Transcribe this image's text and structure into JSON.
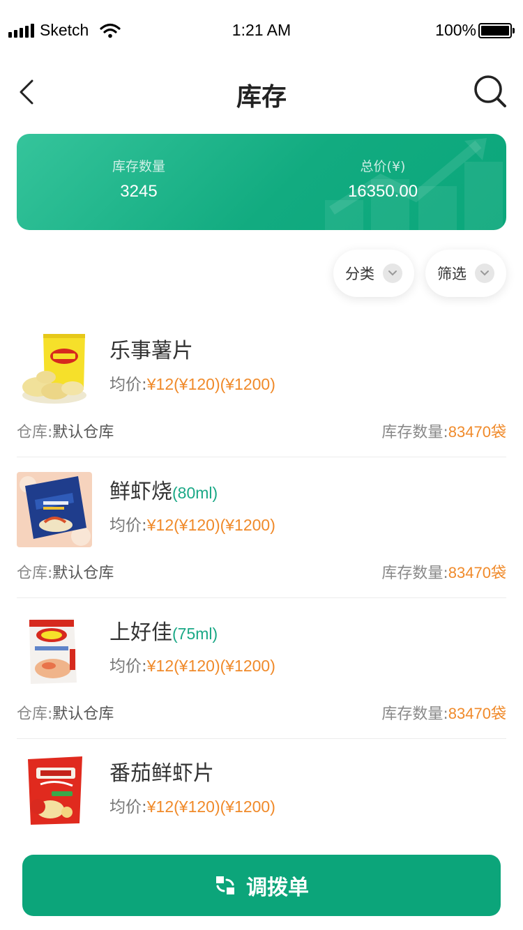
{
  "status_bar": {
    "carrier": "Sketch",
    "time": "1:21 AM",
    "battery": "100%"
  },
  "nav": {
    "title": "库存",
    "back_icon": "chevron-left-icon",
    "search_icon": "search-icon"
  },
  "summary": {
    "stock_label": "库存数量",
    "stock_value": "3245",
    "total_label": "总价(¥)",
    "total_value": "16350.00"
  },
  "filters": {
    "category_label": "分类",
    "filter_label": "筛选"
  },
  "products": [
    {
      "name": "乐事薯片",
      "spec": "",
      "price_label": "均价:",
      "price_value": "¥12(¥120)(¥1200)",
      "warehouse_label": "仓库:",
      "warehouse_name": "默认仓库",
      "stock_label": "库存数量:",
      "stock_value": "83470",
      "stock_unit": "袋"
    },
    {
      "name": "鲜虾烧",
      "spec": "(80ml)",
      "price_label": "均价:",
      "price_value": "¥12(¥120)(¥1200)",
      "warehouse_label": "仓库:",
      "warehouse_name": "默认仓库",
      "stock_label": "库存数量:",
      "stock_value": "83470",
      "stock_unit": "袋"
    },
    {
      "name": "上好佳",
      "spec": "(75ml)",
      "price_label": "均价:",
      "price_value": "¥12(¥120)(¥1200)",
      "warehouse_label": "仓库:",
      "warehouse_name": "默认仓库",
      "stock_label": "库存数量:",
      "stock_value": "83470",
      "stock_unit": "袋"
    },
    {
      "name": "番茄鲜虾片",
      "spec": "",
      "price_label": "均价:",
      "price_value": "¥12(¥120)(¥1200)"
    }
  ],
  "transfer_button": {
    "label": "调拨单",
    "icon": "transfer-icon"
  },
  "colors": {
    "brand_green": "#0ca57a",
    "price_orange": "#f08a2a",
    "spec_green": "#1aa886"
  }
}
